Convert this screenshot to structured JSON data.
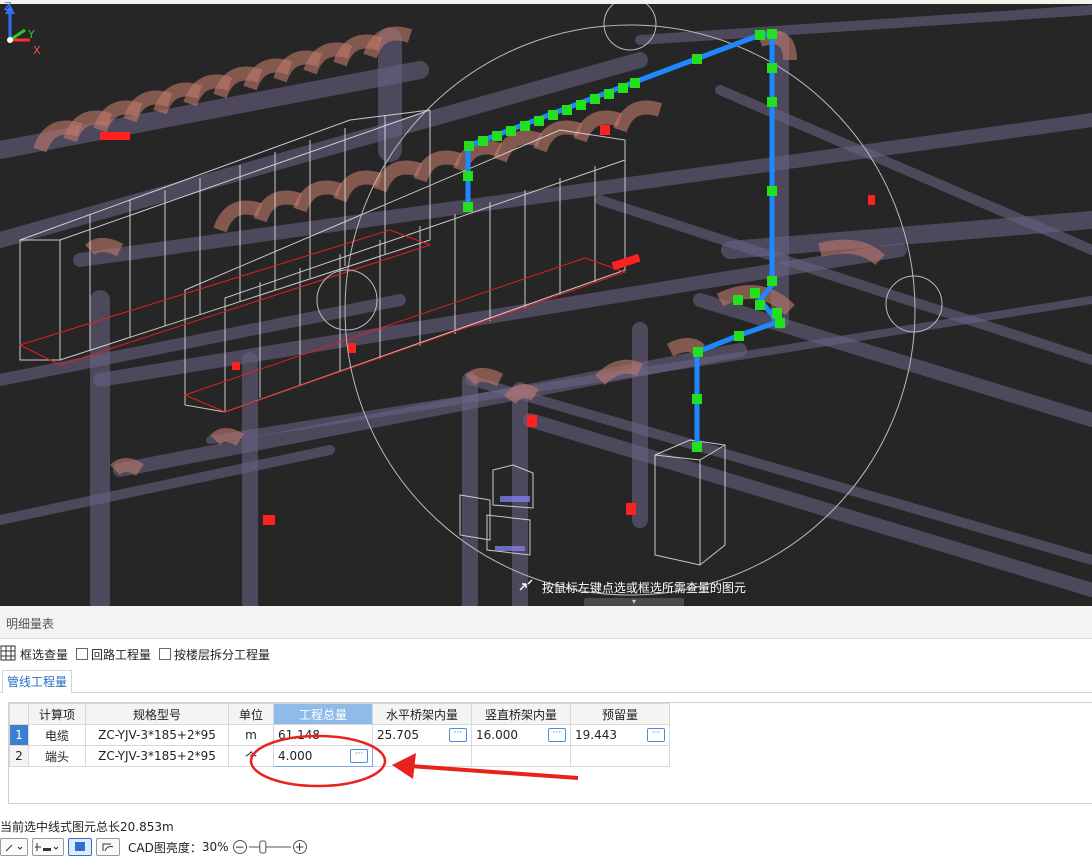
{
  "viewport": {
    "hint_text": "按鼠标左键点选或框选所需查量的图元",
    "axis_labels": {
      "z": "Z",
      "y": "Y",
      "x": "X"
    },
    "colors": {
      "background": "#262626",
      "route": "#1e88ff",
      "node": "#22e01e",
      "pipe": "#7a6e9a",
      "bend": "#c0796a",
      "marker": "#ff2020"
    }
  },
  "panel": {
    "title": "明细量表",
    "toolbar": {
      "box_select_label": "框选查量",
      "circuit_label": "回路工程量",
      "split_by_floor_label": "按楼层拆分工程量",
      "circuit_checked": false,
      "split_by_floor_checked": false
    },
    "tabs": [
      {
        "label": "管线工程量",
        "active": true
      }
    ],
    "table": {
      "columns": [
        "计算项",
        "规格型号",
        "单位",
        "工程总量",
        "水平桥架内量",
        "竖直桥架内量",
        "预留量"
      ],
      "selected_column": "工程总量",
      "rows": [
        {
          "no": "1",
          "item": "电缆",
          "spec": "ZC-YJV-3*185+2*95",
          "unit": "m",
          "total": "61.148",
          "horizontal": "25.705",
          "vertical": "16.000",
          "reserved": "19.443"
        },
        {
          "no": "2",
          "item": "端头",
          "spec": "ZC-YJV-3*185+2*95",
          "unit": "个",
          "total": "4.000",
          "horizontal": "",
          "vertical": "",
          "reserved": ""
        }
      ]
    }
  },
  "status_text": "当前选中线式图元总长20.853m",
  "bottom": {
    "cad_brightness_label": "CAD图亮度：",
    "cad_brightness_value": "30%",
    "cad_brightness_fraction": 0.3
  },
  "annotation": {
    "color": "#e8231e"
  }
}
